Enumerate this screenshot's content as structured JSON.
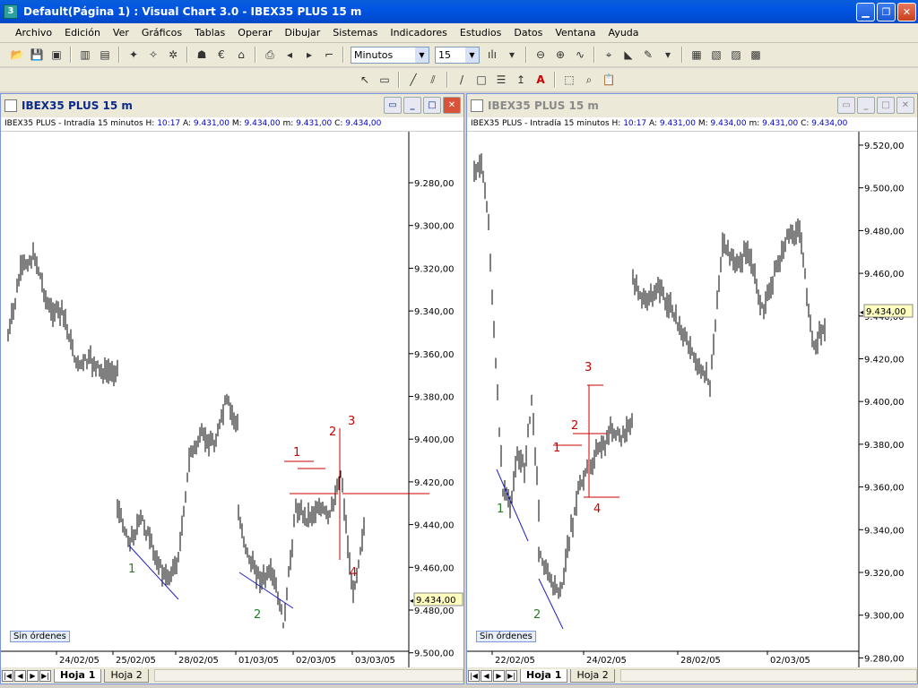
{
  "app": {
    "title": "Default(Página 1) : Visual Chart  3.0 - IBEX35 PLUS 15 m",
    "icon": "visual-chart-icon"
  },
  "menu": [
    "Archivo",
    "Edición",
    "Ver",
    "Gráficos",
    "Tablas",
    "Operar",
    "Dibujar",
    "Sistemas",
    "Indicadores",
    "Estudios",
    "Datos",
    "Ventana",
    "Ayuda"
  ],
  "toolbar": {
    "period_value": "Minutos",
    "interval_value": "15"
  },
  "windows": [
    {
      "title": "IBEX35 PLUS 15 m",
      "info_prefix": "IBEX35 PLUS - Intradía 15 minutos ",
      "h": "10:17",
      "a": "9.431,00",
      "m": "9.434,00",
      "min": "9.431,00",
      "c": "9.434,00",
      "price_ticks": [
        "9.280,00",
        "9.300,00",
        "9.320,00",
        "9.340,00",
        "9.360,00",
        "9.380,00",
        "9.400,00",
        "9.420,00",
        "9.440,00",
        "9.460,00",
        "9.480,00",
        "9.500,00"
      ],
      "current_price": "9.434,00",
      "dates": [
        "24/02/05",
        "25/02/05",
        "28/02/05",
        "01/03/05",
        "02/03/05",
        "03/03/05"
      ],
      "orders": "Sin órdenes",
      "sheet_tabs": [
        "Hoja 1",
        "Hoja 2"
      ],
      "wave_labels": {
        "w1": "1",
        "w2": "2",
        "r1": "1",
        "r2": "2",
        "r3": "3",
        "r4": "4"
      }
    },
    {
      "title": "IBEX35 PLUS 15 m",
      "info_prefix": "IBEX35 PLUS - Intradía 15 minutos ",
      "h": "10:17",
      "a": "9.431,00",
      "m": "9.434,00",
      "min": "9.431,00",
      "c": "9.434,00",
      "price_ticks": [
        "9.520,00",
        "9.500,00",
        "9.480,00",
        "9.460,00",
        "9.440,00",
        "9.420,00",
        "9.400,00",
        "9.380,00",
        "9.360,00",
        "9.340,00",
        "9.320,00",
        "9.300,00",
        "9.280,00"
      ],
      "current_price": "9.434,00",
      "dates": [
        "22/02/05",
        "24/02/05",
        "28/02/05",
        "02/03/05"
      ],
      "orders": "Sin órdenes",
      "sheet_tabs": [
        "Hoja 1",
        "Hoja 2"
      ],
      "wave_labels": {
        "w1": "1",
        "w2": "2",
        "r1": "1",
        "r2": "2",
        "r3": "3",
        "r4": "4"
      }
    }
  ],
  "colors": {
    "wave_green": "#2a7a2a",
    "wave_red": "#cc0000",
    "trend_blue": "#2020c0"
  }
}
